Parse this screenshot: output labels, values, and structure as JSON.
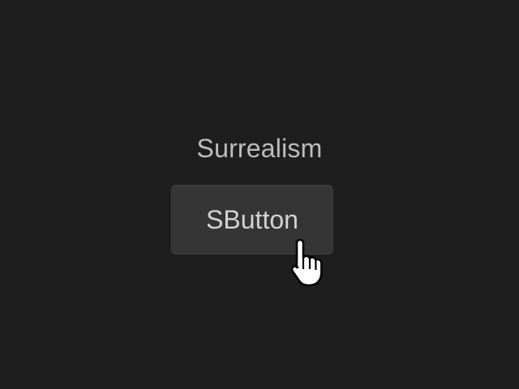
{
  "heading": {
    "text": "Surrealism"
  },
  "sbutton": {
    "label": "SButton"
  },
  "cursor": {
    "icon": "hand-pointer-icon"
  },
  "colors": {
    "background": "#1e1e1e",
    "heading_text": "#bdbdbd",
    "button_bg": "#353535",
    "button_text": "#d2d2d2"
  }
}
